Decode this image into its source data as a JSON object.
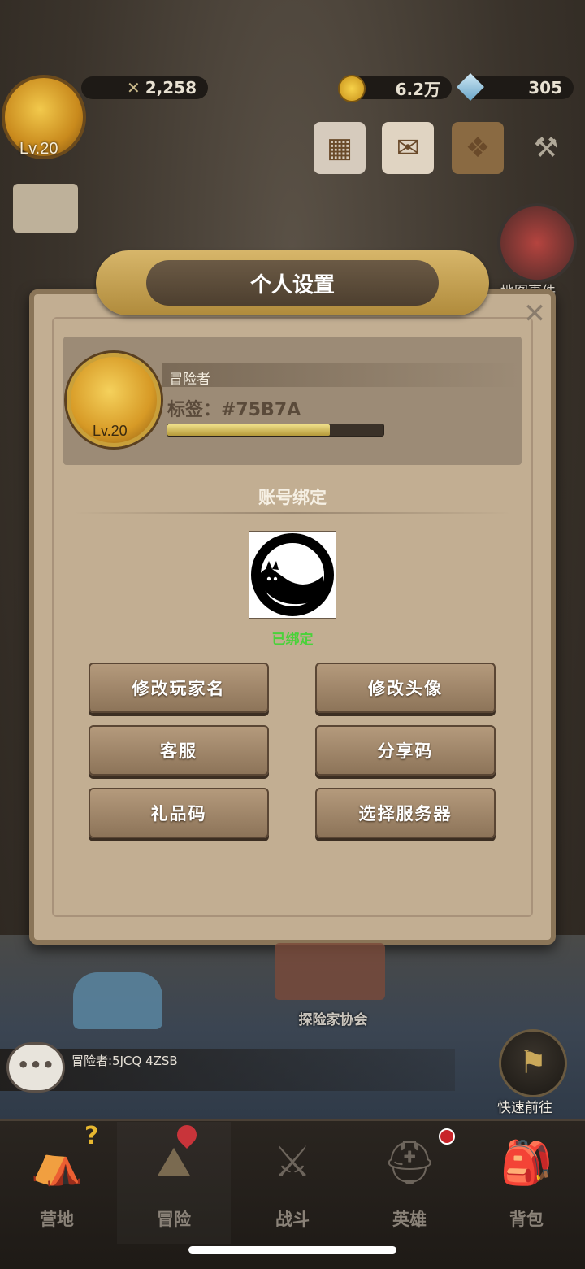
{
  "hud": {
    "power": "2,258",
    "gold": "6.2万",
    "gems": "305",
    "level": "Lv.20",
    "map_event_label": "地图事件"
  },
  "dialog": {
    "title": "个人设置",
    "close_icon": "close-icon",
    "player": {
      "name": "冒险者",
      "tag": "标签：#75B7A",
      "level": "Lv.20",
      "xp_fraction": 0.75
    },
    "section_title": "账号绑定",
    "bind_status": "已绑定",
    "buttons": {
      "rename": "修改玩家名",
      "change_avatar": "修改头像",
      "support": "客服",
      "share_code": "分享码",
      "gift_code": "礼品码",
      "select_server": "选择服务器"
    }
  },
  "scene": {
    "association_label": "探险家协会",
    "chat_text": "冒险者:5JCQ 4ZSB",
    "quick_travel": "快速前往"
  },
  "nav": [
    {
      "label": "营地",
      "icon": "camp-icon"
    },
    {
      "label": "冒险",
      "icon": "map-icon"
    },
    {
      "label": "战斗",
      "icon": "crossed-swords-icon"
    },
    {
      "label": "英雄",
      "icon": "helmet-icon"
    },
    {
      "label": "背包",
      "icon": "backpack-icon"
    }
  ],
  "colors": {
    "bind_status": "#4ad23a",
    "dialog_bg": "#c2ae92"
  }
}
